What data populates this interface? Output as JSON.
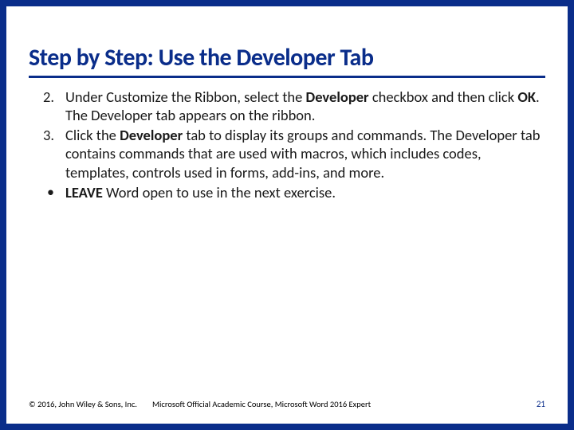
{
  "title": "Step by Step: Use the Developer Tab",
  "items": [
    {
      "marker": "2.",
      "html": "Under Customize the Ribbon, select the <b>Developer</b> checkbox and then click <b>OK</b>. The Developer tab appears on the ribbon."
    },
    {
      "marker": "3.",
      "html": "Click the <b>Developer</b> tab to display its groups and commands. The Developer tab contains commands that are used with macros, which includes codes, templates, controls used in forms, add-ins, and more."
    },
    {
      "marker": "•",
      "is_bullet": true,
      "html": "<b>LEAVE</b> Word open to use in the next exercise."
    }
  ],
  "footer": {
    "copyright": "© 2016, John Wiley & Sons, Inc.",
    "course": "Microsoft Official Academic Course, Microsoft Word 2016 Expert",
    "page": "21"
  }
}
